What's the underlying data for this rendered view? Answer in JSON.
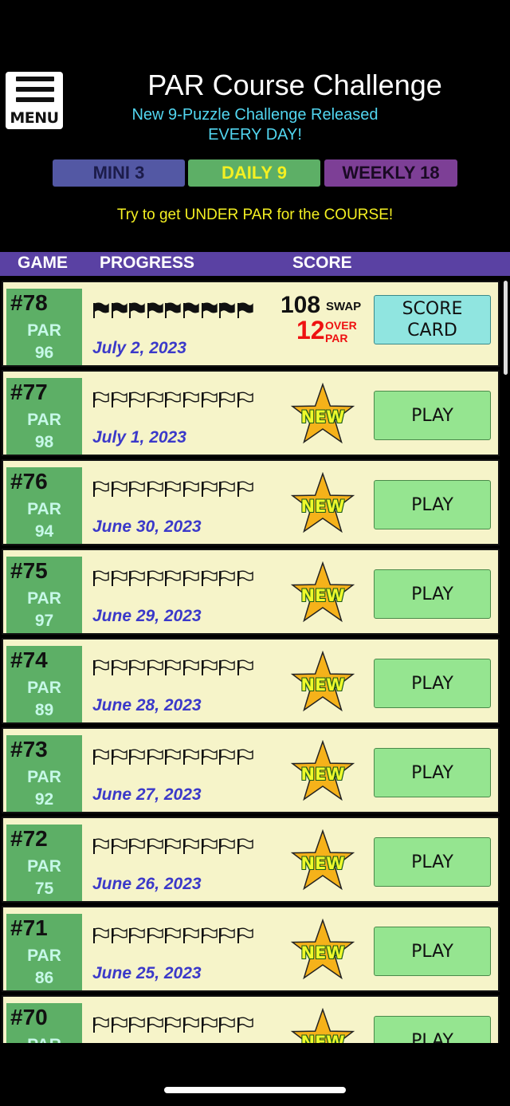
{
  "menu": {
    "label": "MENU"
  },
  "header": {
    "title": "PAR Course Challenge",
    "subtitle_line1": "New 9-Puzzle Challenge Released",
    "subtitle_line2": "EVERY DAY!"
  },
  "tabs": [
    {
      "label": "MINI 3",
      "bg": "#5358a4",
      "fg": "#1c1c4a",
      "active": false
    },
    {
      "label": "DAILY 9",
      "bg": "#5daf66",
      "fg": "#f4f022",
      "active": true
    },
    {
      "label": "WEEKLY 18",
      "bg": "#7d3f96",
      "fg": "#1a0a24",
      "active": false
    }
  ],
  "tagline": "Try to get UNDER PAR for the COURSE!",
  "columns": {
    "game": "GAME",
    "progress": "PROGRESS",
    "score": "SCORE"
  },
  "par_label": "PAR",
  "new_label": "NEW",
  "play_label": "PLAY",
  "games": [
    {
      "number": "#78",
      "par": "96",
      "date": "July 2, 2023",
      "status": "done",
      "flags_done": 9,
      "score": "108",
      "score_unit": "SWAP",
      "over": "12",
      "over_label1": "OVER",
      "over_label2": "PAR",
      "action": "SCORE CARD"
    },
    {
      "number": "#77",
      "par": "98",
      "date": "July 1, 2023",
      "status": "new",
      "flags_done": 0
    },
    {
      "number": "#76",
      "par": "94",
      "date": "June 30, 2023",
      "status": "new",
      "flags_done": 0
    },
    {
      "number": "#75",
      "par": "97",
      "date": "June 29, 2023",
      "status": "new",
      "flags_done": 0
    },
    {
      "number": "#74",
      "par": "89",
      "date": "June 28, 2023",
      "status": "new",
      "flags_done": 0
    },
    {
      "number": "#73",
      "par": "92",
      "date": "June 27, 2023",
      "status": "new",
      "flags_done": 0
    },
    {
      "number": "#72",
      "par": "75",
      "date": "June 26, 2023",
      "status": "new",
      "flags_done": 0
    },
    {
      "number": "#71",
      "par": "86",
      "date": "June 25, 2023",
      "status": "new",
      "flags_done": 0
    },
    {
      "number": "#70",
      "par": "",
      "date": "",
      "status": "new",
      "flags_done": 0
    }
  ],
  "icons": {
    "menu": "hamburger-icon",
    "flag": "flag-icon",
    "star": "star-icon"
  },
  "colors": {
    "accent_purple": "#5a41a3",
    "row_bg": "#f6f4c9",
    "game_green": "#5daf66",
    "date_blue": "#3b39c9",
    "star": "#f5b21a",
    "over_red": "#e11111"
  }
}
